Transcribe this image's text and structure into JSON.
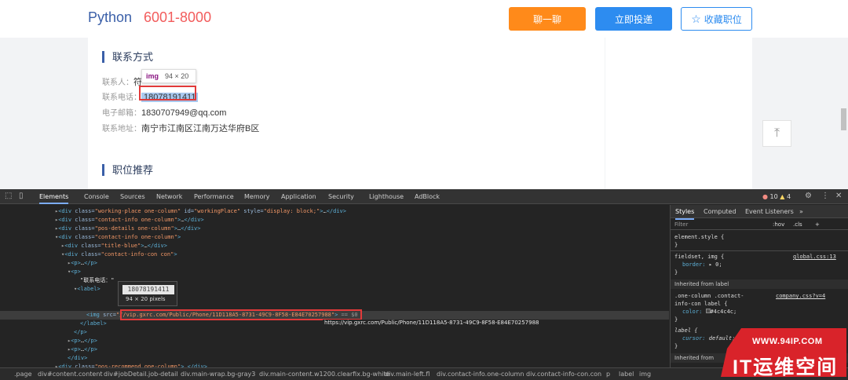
{
  "webpage": {
    "job_title": "Python",
    "salary": "6001-8000",
    "btn_chat": "聊一聊",
    "btn_apply": "立即投递",
    "btn_fav": "收藏职位",
    "contact_title": "联系方式",
    "contact_person_label": "联系人：",
    "contact_person_value": "符",
    "phone_label": "联系电话：",
    "phone_value": "18078191411",
    "email_label": "电子邮箱：",
    "email_value": "1830707949@qq.com",
    "address_label": "联系地址：",
    "address_value": "南宁市江南区江南万达华府B区",
    "recommend_title": "职位推荐",
    "img_tip_tag": "img",
    "img_tip_dim": "94 × 20"
  },
  "devtools": {
    "tabs": [
      "Elements",
      "Console",
      "Sources",
      "Network",
      "Performance",
      "Memory",
      "Application",
      "Security",
      "Lighthouse",
      "AdBlock"
    ],
    "errors": "10",
    "warnings": "4",
    "dom": {
      "l1_class": "working-place one-column",
      "l1_id": "workingPlace",
      "l1_style": "display: block;",
      "l2_class": "contact-info one-column",
      "l3_class": "pos-details one-column",
      "l4_class": "contact-info one-column",
      "l5_class": "title-blue",
      "l6_class": "contact-info-con con",
      "l9_text": "\"联系电话：\"",
      "img_src": "//vip.gxrc.com/Public/Phone/11D118A5-8731-49C9-8F58-E84E70257988",
      "eq_s0": "== $0",
      "url_tip": "https://vip.gxrc.com/Public/Phone/11D118A5-8731-49C9-8F58-E84E70257988",
      "preview_text": "18078191411",
      "preview_size": "94 × 20 pixels",
      "recommend_class": "pos-recommend one-column"
    },
    "styles": {
      "tabs": [
        "Styles",
        "Computed",
        "Event Listeners"
      ],
      "filter": "Filter",
      "hov": ":hov",
      "cls": ".cls",
      "element_style": "element.style {",
      "rule1_selector": "fieldset, img {",
      "rule1_source": "global.css:13",
      "rule1_prop": "border:",
      "rule1_val": "▸ 0;",
      "inherited1": "Inherited from label",
      "rule2_selector_a": ".one-column .contact-",
      "rule2_selector_b": "info-con label {",
      "rule2_source": "company.css?v=4",
      "rule2_prop": "color:",
      "rule2_val": "#4c4c4c;",
      "rule3_selector": "label {",
      "rule3_prop": "cursor:",
      "rule3_val": "default;",
      "inherited2": "Inherited from",
      "close_brace": "}"
    },
    "breadcrumbs": [
      ".page",
      "div#content.content",
      "div#jobDetail.job-detail",
      "div.main-wrap.bg-gray3",
      "div.main-content.w1200.clearfix.bg-white",
      "div.main-left.fl",
      "div.contact-info.one-column",
      "div.contact-info-con.con",
      "p",
      "label",
      "img"
    ]
  },
  "watermark": {
    "url": "WWW.94IP.COM",
    "brand": "IT运维空间"
  }
}
